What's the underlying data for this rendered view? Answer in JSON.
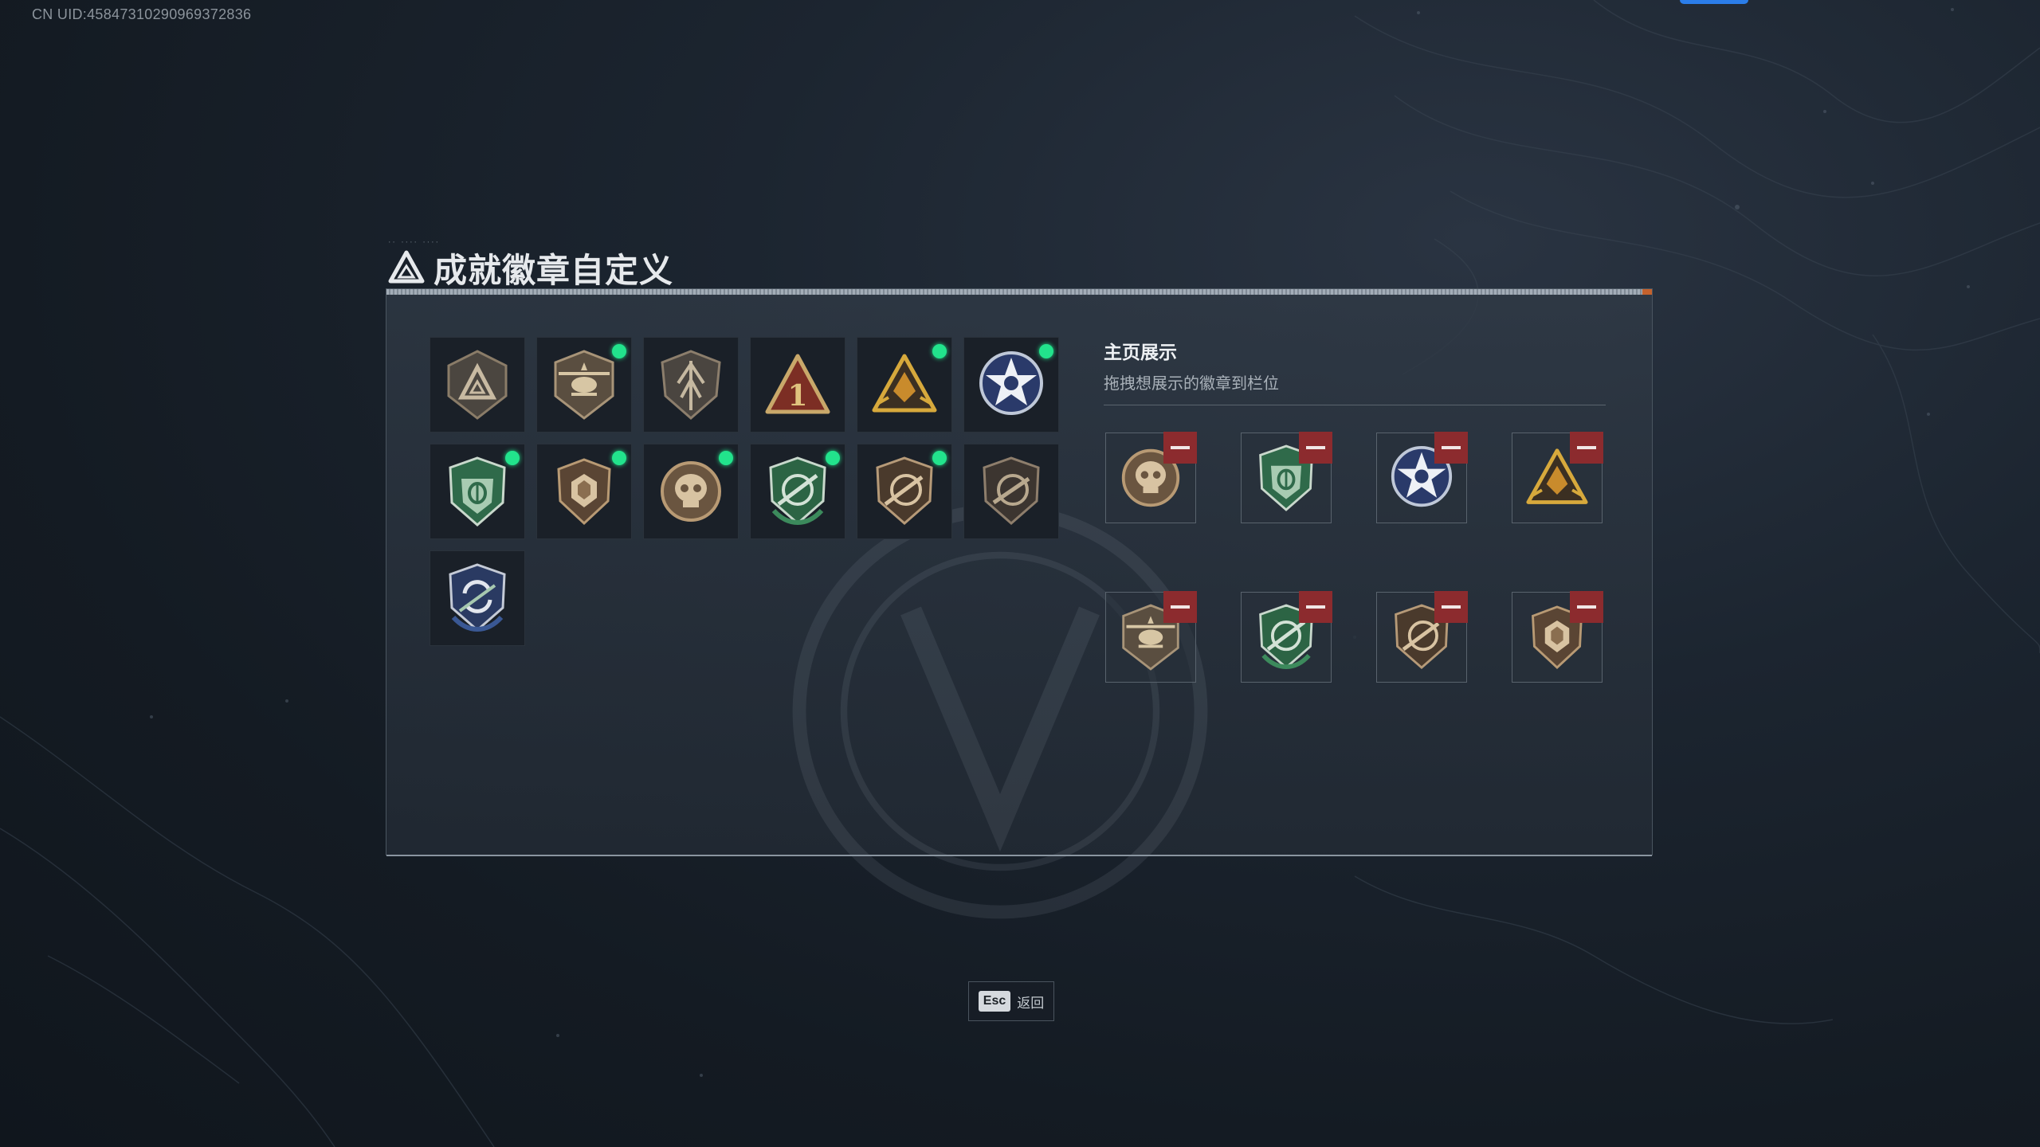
{
  "uid_text": "CN UID:4584731029096​9372836",
  "title": "成就徽章自定义",
  "title_tick": "·· ···· ····",
  "showcase": {
    "title": "主页展示",
    "subtitle": "拖拽想展示的徽章到栏位"
  },
  "badges": [
    {
      "icon": "triangle-emblem-icon",
      "new": false
    },
    {
      "icon": "helicopter-badge-icon",
      "new": true
    },
    {
      "icon": "arrow-shield-icon",
      "new": false
    },
    {
      "icon": "rank-one-triangle-icon",
      "new": false
    },
    {
      "icon": "gold-triangle-emblem-icon",
      "new": true
    },
    {
      "icon": "star-skull-badge-icon",
      "new": true
    },
    {
      "icon": "green-eye-shield-icon",
      "new": true
    },
    {
      "icon": "bronze-hexagon-shield-icon",
      "new": true
    },
    {
      "icon": "bronze-skull-medallion-icon",
      "new": true
    },
    {
      "icon": "green-rifle-shield-icon",
      "new": true
    },
    {
      "icon": "bronze-rifle-shield-icon",
      "new": true
    },
    {
      "icon": "dark-rifle-shield-icon",
      "new": false
    },
    {
      "icon": "blue-recycle-shield-icon",
      "new": false
    }
  ],
  "slots": [
    {
      "icon": "bronze-skull-medallion-icon"
    },
    {
      "icon": "green-eye-shield-icon"
    },
    {
      "icon": "star-skull-badge-icon"
    },
    {
      "icon": "gold-triangle-emblem-icon"
    },
    {
      "icon": "helicopter-badge-icon"
    },
    {
      "icon": "green-rifle-shield-icon"
    },
    {
      "icon": "bronze-rifle-shield-icon"
    },
    {
      "icon": "bronze-hexagon-shield-icon"
    }
  ],
  "esc": {
    "key": "Esc",
    "label": "返回"
  },
  "colors": {
    "new_dot": "#22e38c",
    "remove": "#8c2b2e",
    "accent": "#2b7de9"
  }
}
